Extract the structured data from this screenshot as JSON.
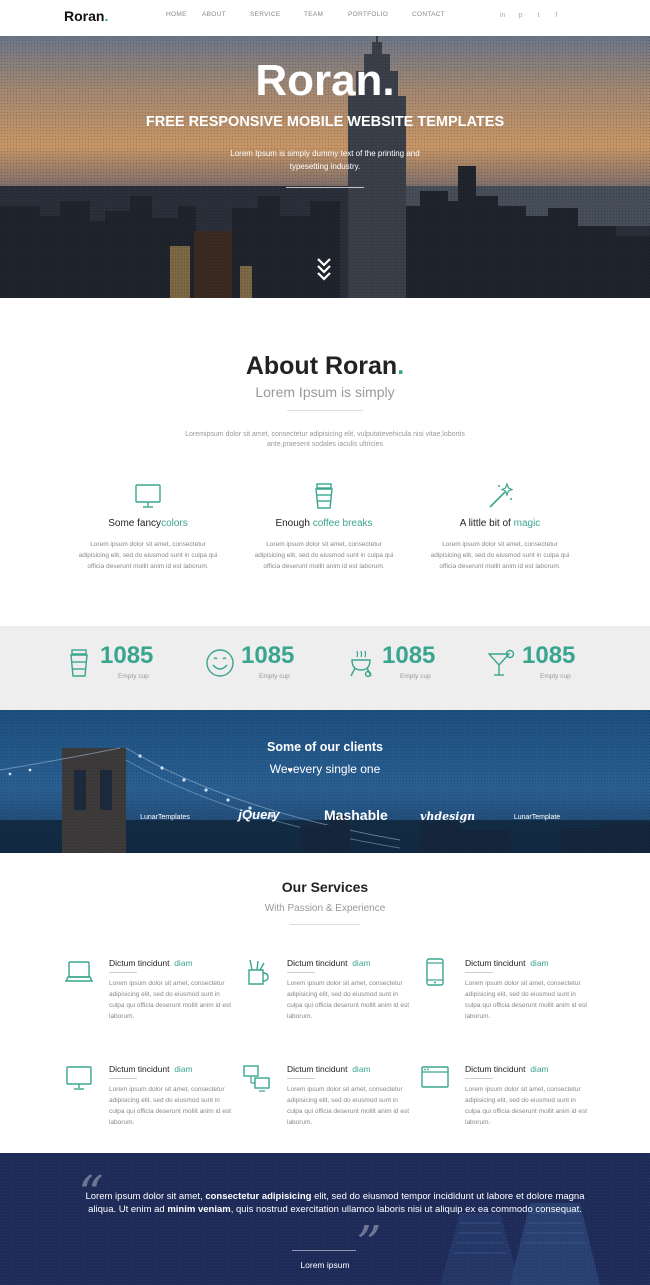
{
  "brand": {
    "name": "Roran",
    "dot": ".",
    "accent": "#3aa58f"
  },
  "nav": {
    "items": [
      "HOME",
      "ABOUT",
      "SERVICE",
      "TEAM",
      "PORTFOLIO",
      "CONTACT"
    ],
    "social": [
      "in",
      "p",
      "t",
      "f"
    ]
  },
  "hero": {
    "title": "Roran.",
    "subtitle": "FREE RESPONSIVE MOBILE WEBSITE TEMPLATES",
    "description": "Lorem Ipsum is simply dummy text of the printing and typesetting industry."
  },
  "about": {
    "title": "About Roran",
    "dot": ".",
    "subtitle": "Lorem Ipsum is simply",
    "description": "Loremipsum dolor sit amet, consectetur adipisicing elit, vulputatevehicula nisi vitae,lobortis ante,praesent sodales iaculis ultricies",
    "features": [
      {
        "title_pre": "Some fancy",
        "title_acc": "colors",
        "icon": "monitor-icon",
        "body": "Lorem ipsum dolor sit amet, consectetur adipisicing elit, sed do eiusmod sunt in culpa qui officia deserunt mollit anim id est laborum."
      },
      {
        "title_pre": "Enough ",
        "title_acc": "coffee breaks",
        "icon": "coffee-cup-icon",
        "body": "Lorem ipsum dolor sit amet, consectetur adipisicing elit, sed do eiusmod sunt in culpa qui officia deserunt mollit anim id est laborum."
      },
      {
        "title_pre": "A little bit of ",
        "title_acc": "magic",
        "icon": "magic-wand-icon",
        "body": "Lorem ipsum dolor sit amet, consectetur adipisicing elit, sed do eiusmod sunt in culpa qui officia deserunt mollit anim id est laborum."
      }
    ]
  },
  "stats": [
    {
      "value": "1085",
      "label": "Empty cup",
      "icon": "cup-icon"
    },
    {
      "value": "1085",
      "label": "Empty cup",
      "icon": "smiley-icon"
    },
    {
      "value": "1085",
      "label": "Empty cup",
      "icon": "grill-icon"
    },
    {
      "value": "1085",
      "label": "Empty cup",
      "icon": "cocktail-icon"
    }
  ],
  "clients": {
    "title": "Some of our clients",
    "subtitle_pre": "We",
    "heart": "♥",
    "subtitle_post": "every single one",
    "logos": [
      "LunarTemplates",
      "jQuery",
      "Mashable",
      "vhdesign",
      "LunarTemplate"
    ]
  },
  "services": {
    "title": "Our Services",
    "subtitle": "With Passion & Experience",
    "items": [
      {
        "title_pre": "Dictum tincidunt",
        "title_acc": "diam",
        "icon": "laptop-icon",
        "body": "Lorem ipsum dolor sit amet, consectetur adipisicing elit, sed do eiusmod sunt in culpa qui officia deserunt mollit anim id est laborum."
      },
      {
        "title_pre": "Dictum tincidunt",
        "title_acc": "diam",
        "icon": "pencil-cup-icon",
        "body": "Lorem ipsum dolor sit amet, consectetur adipisicing elit, sed do eiusmod sunt in culpa qui officia deserunt mollit anim id est laborum."
      },
      {
        "title_pre": "Dictum tincidunt",
        "title_acc": "diam",
        "icon": "tablet-icon",
        "body": "Lorem ipsum dolor sit amet, consectetur adipisicing elit, sed do eiusmod sunt in culpa qui officia deserunt mollit anim id est laborum."
      },
      {
        "title_pre": "Dictum tincidunt",
        "title_acc": "diam",
        "icon": "monitor-icon",
        "body": "Lorem ipsum dolor sit amet, consectetur adipisicing elit, sed do eiusmod sunt in culpa qui officia deserunt mollit anim id est laborum."
      },
      {
        "title_pre": "Dictum tincidunt",
        "title_acc": "diam",
        "icon": "network-icon",
        "body": "Lorem ipsum dolor sit amet, consectetur adipisicing elit, sed do eiusmod sunt in culpa qui officia deserunt mollit anim id est laborum."
      },
      {
        "title_pre": "Dictum tincidunt",
        "title_acc": "diam",
        "icon": "browser-window-icon",
        "body": "Lorem ipsum dolor sit amet, consectetur adipisicing elit, sed do eiusmod sunt in culpa qui officia deserunt mollit anim id est laborum."
      }
    ]
  },
  "quote": {
    "t1": "Lorem ipsum dolor sit amet, ",
    "b1": "consectetur adipisicing",
    "t2": " elit, sed do eiusmod tempor incididunt ut labore et dolore magna aliqua. Ut enim ad ",
    "b2": "minim veniam",
    "t3": ", quis nostrud exercitation ullamco laboris nisi ut aliquip ex ea commodo consequat.",
    "author": "Lorem ipsum"
  }
}
